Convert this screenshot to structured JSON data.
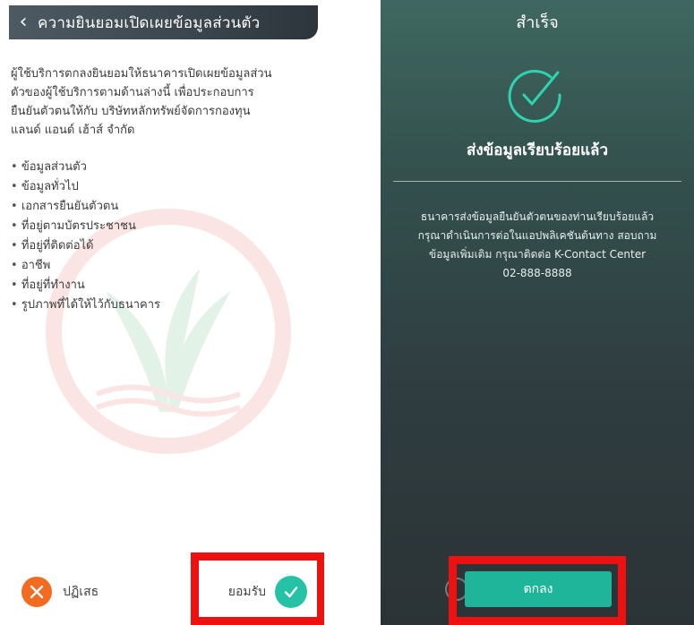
{
  "left": {
    "title": "ความยินยอมเปิดเผยข้อมูลส่วนตัว",
    "back_icon": "chevron-left-icon",
    "paragraph_lines": [
      "ผู้ใช้บริการตกลงยินยอมให้ธนาคารเปิดเผยข้อมูลส่วน",
      "ตัวของผู้ใช้บริการตามด้านล่างนี้ เพื่อประกอบการ",
      "ยืนยันตัวตนให้กับ บริษัทหลักทรัพย์จัดการกองทุน",
      "แลนด์ แอนด์ เฮ้าส์ จำกัด"
    ],
    "items": [
      "ข้อมูลส่วนตัว",
      "ข้อมูลทั่วไป",
      "เอกสารยืนยันตัวตน",
      "ที่อยู่ตามบัตรประชาชน",
      "ที่อยู่ที่ติดต่อได้",
      "อาชีพ",
      "ที่อยู่ที่ทำงาน",
      "รูปภาพที่ได้ให้ไว้กับธนาคาร"
    ],
    "decline_label": "ปฏิเสธ",
    "accept_label": "ยอมรับ"
  },
  "right": {
    "title": "สำเร็จ",
    "heading": "ส่งข้อมูลเรียบร้อยแล้ว",
    "message_lines": [
      "ธนาคารส่งข้อมูลยืนยันตัวตนของท่านเรียบร้อยแล้ว",
      "กรุณาดำเนินการต่อในแอปพลิเคชันต้นทาง สอบถาม",
      "ข้อมูลเพิ่มเติม กรุณาติดต่อ K-Contact Center",
      "02-888-8888"
    ],
    "ok_label": "ตกลง"
  },
  "colors": {
    "header_dark": "#3a454d",
    "accent_teal": "#26c2a5",
    "decline_orange": "#f26b21",
    "highlight_red": "#ee1111"
  }
}
